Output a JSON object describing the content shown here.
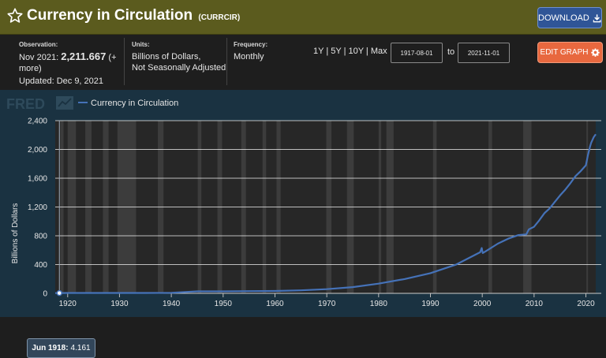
{
  "header": {
    "title": "Currency in Circulation",
    "series_id": "(CURRCIR)",
    "download_label": "DOWNLOAD",
    "bg_color": "#5b5b1e"
  },
  "meta": {
    "observation_label": "Observation:",
    "observation_date": "Nov 2021:",
    "observation_value": "2,211.667",
    "observation_more": "(+ more)",
    "updated": "Updated: Dec 9, 2021",
    "units_label": "Units:",
    "units_line1": "Billions of Dollars,",
    "units_line2": "Not Seasonally Adjusted",
    "frequency_label": "Frequency:",
    "frequency_value": "Monthly"
  },
  "range": {
    "links": [
      "1Y",
      "5Y",
      "10Y",
      "Max"
    ],
    "start_date": "1917-08-01",
    "to_label": "to",
    "end_date": "2021-11-01",
    "edit_label": "EDIT GRAPH"
  },
  "tooltip": {
    "date": "Jun 1918:",
    "value": "4.161"
  },
  "chart_data": {
    "type": "line",
    "logo": "FRED",
    "legend": "Currency in Circulation",
    "ylabel": "Billions of Dollars",
    "xlim": [
      1917.6,
      2021.9
    ],
    "ylim": [
      0,
      2400
    ],
    "yticks": [
      0,
      400,
      800,
      1200,
      1600,
      2000,
      2400
    ],
    "ytick_labels": [
      "0",
      "400",
      "800",
      "1,200",
      "1,600",
      "2,000",
      "2,400"
    ],
    "xticks": [
      1920,
      1930,
      1940,
      1950,
      1960,
      1970,
      1980,
      1990,
      2000,
      2010,
      2020
    ],
    "grid": true,
    "line_color": "#4572b8",
    "recession_color": "#3c3c3c",
    "background_color": "#272727",
    "series": [
      {
        "name": "Currency in Circulation",
        "x": [
          1917.6,
          1918.4,
          1920,
          1925,
          1930,
          1935,
          1940,
          1945,
          1950,
          1955,
          1960,
          1965,
          1970,
          1975,
          1980,
          1985,
          1990,
          1995,
          1999.6,
          1999.9,
          2000.1,
          2001,
          2003,
          2005,
          2007,
          2008.5,
          2009,
          2010,
          2011,
          2012,
          2013,
          2014,
          2015,
          2016,
          2017,
          2018,
          2019,
          2020,
          2020.4,
          2020.8,
          2021,
          2021.5,
          2021.9
        ],
        "y": [
          4,
          4.161,
          6,
          5,
          5,
          6,
          8,
          27,
          27,
          31,
          33,
          42,
          58,
          87,
          135,
          198,
          280,
          401,
          571,
          630,
          560,
          600,
          690,
          760,
          810,
          820,
          890,
          925,
          1015,
          1115,
          1180,
          1270,
          1360,
          1440,
          1530,
          1630,
          1700,
          1780,
          1920,
          2040,
          2090,
          2170,
          2212
        ]
      }
    ],
    "recessions": [
      [
        1918.6,
        1919.2
      ],
      [
        1920.0,
        1921.6
      ],
      [
        1923.4,
        1924.6
      ],
      [
        1926.8,
        1927.9
      ],
      [
        1929.6,
        1933.2
      ],
      [
        1937.4,
        1938.5
      ],
      [
        1945.1,
        1945.8
      ],
      [
        1948.9,
        1949.8
      ],
      [
        1953.5,
        1954.4
      ],
      [
        1957.6,
        1958.3
      ],
      [
        1960.3,
        1961.1
      ],
      [
        1969.9,
        1970.9
      ],
      [
        1973.9,
        1975.2
      ],
      [
        1980.0,
        1980.5
      ],
      [
        1981.5,
        1982.9
      ],
      [
        1990.5,
        1991.2
      ],
      [
        2001.2,
        2001.9
      ],
      [
        2007.9,
        2009.5
      ],
      [
        2020.1,
        2020.4
      ]
    ]
  }
}
